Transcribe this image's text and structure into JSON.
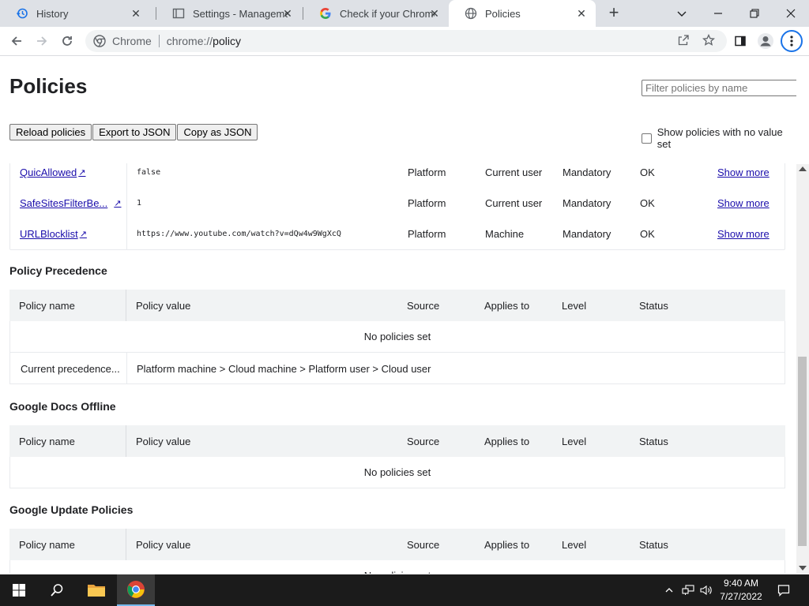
{
  "browser": {
    "tabs": [
      {
        "title": "History",
        "icon": "history-icon",
        "active": false
      },
      {
        "title": "Settings - Management",
        "icon": "settings-icon",
        "active": false
      },
      {
        "title": "Check if your Chrome brow",
        "icon": "google-icon",
        "active": false
      },
      {
        "title": "Policies",
        "icon": "globe-icon",
        "active": true
      }
    ],
    "omnibox": {
      "site_label": "Chrome",
      "url_prefix": "chrome://",
      "url_path": "policy"
    }
  },
  "page": {
    "title": "Policies",
    "filter_placeholder": "Filter policies by name",
    "buttons": {
      "reload": "Reload policies",
      "export": "Export to JSON",
      "copy": "Copy as JSON"
    },
    "show_no_value_label": "Show policies with no value set",
    "show_no_value_checked": false
  },
  "chrome_policies": {
    "rows": [
      {
        "name": "QuicAllowed",
        "value": "false",
        "source": "Platform",
        "applies_to": "Current user",
        "level": "Mandatory",
        "status": "OK",
        "more": "Show more"
      },
      {
        "name": "SafeSitesFilterBe...",
        "value": "1",
        "source": "Platform",
        "applies_to": "Current user",
        "level": "Mandatory",
        "status": "OK",
        "more": "Show more"
      },
      {
        "name": "URLBlocklist",
        "value": "https://www.youtube.com/watch?v=dQw4w9WgXcQ",
        "source": "Platform",
        "applies_to": "Machine",
        "level": "Mandatory",
        "status": "OK",
        "more": "Show more"
      }
    ]
  },
  "headers": {
    "name": "Policy name",
    "value": "Policy value",
    "source": "Source",
    "applies_to": "Applies to",
    "level": "Level",
    "status": "Status"
  },
  "sections": {
    "precedence": {
      "title": "Policy Precedence",
      "empty_text": "No policies set",
      "current_label": "Current precedence...",
      "current_value": "Platform machine > Cloud machine > Platform user > Cloud user"
    },
    "docs_offline": {
      "title": "Google Docs Offline",
      "empty_text": "No policies set"
    },
    "update": {
      "title": "Google Update Policies",
      "empty_text": "No policies set"
    }
  },
  "taskbar": {
    "time": "9:40 AM",
    "date": "7/27/2022"
  },
  "colors": {
    "link": "#1a0dab",
    "header_bg": "#f1f3f4",
    "taskbar_bg": "#1b1b1b",
    "accent": "#1a73e8"
  }
}
